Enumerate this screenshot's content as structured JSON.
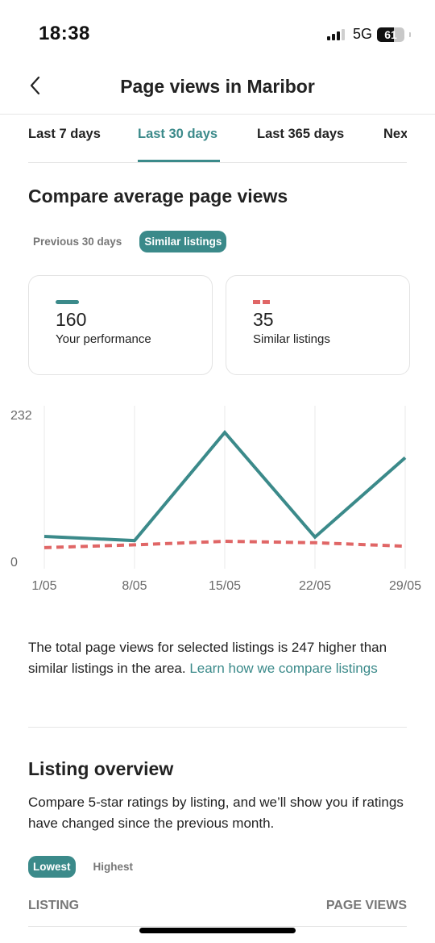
{
  "status_bar": {
    "time": "18:38",
    "network": "5G",
    "battery": "61",
    "battery_level": 0.61
  },
  "nav": {
    "back_icon": "chevron-left-icon",
    "title": "Page views in Maribor"
  },
  "tabs": [
    {
      "label": "Last 7 days",
      "active": false
    },
    {
      "label": "Last 30 days",
      "active": true
    },
    {
      "label": "Last 365 days",
      "active": false
    },
    {
      "label": "Nex",
      "active": false
    }
  ],
  "compare": {
    "title": "Compare average page views",
    "chips": [
      {
        "label": "Previous 30 days",
        "active": false
      },
      {
        "label": "Similar listings",
        "active": true
      }
    ],
    "cards": [
      {
        "value": "160",
        "label": "Your performance",
        "legend": "solid",
        "color": "#3b8a8a"
      },
      {
        "value": "35",
        "label": "Similar listings",
        "legend": "dashed",
        "color": "#e06666"
      }
    ]
  },
  "chart_data": {
    "type": "line",
    "x": [
      "1/05",
      "8/05",
      "15/05",
      "22/05",
      "29/05"
    ],
    "series": [
      {
        "name": "Your performance",
        "style": "solid",
        "color": "#3b8a8a",
        "values": [
          46,
          40,
          194,
          45,
          158
        ]
      },
      {
        "name": "Similar listings",
        "style": "dashed",
        "color": "#e06666",
        "values": [
          30,
          34,
          39,
          37,
          32
        ]
      }
    ],
    "yticks": [
      "232",
      "0"
    ],
    "ylim": [
      0,
      232
    ],
    "grid": "vertical",
    "title": "",
    "xlabel": "",
    "ylabel": ""
  },
  "summary": {
    "text": "The total page views for selected listings is 247 higher than similar listings in the area. ",
    "link": "Learn how we compare listings"
  },
  "overview": {
    "title": "Listing overview",
    "description": "Compare 5-star ratings by listing, and we’ll show you if ratings have changed since the previous month.",
    "chips": [
      {
        "label": "Lowest",
        "active": true
      },
      {
        "label": "Highest",
        "active": false
      }
    ],
    "table_headers": [
      "LISTING",
      "PAGE VIEWS"
    ]
  }
}
